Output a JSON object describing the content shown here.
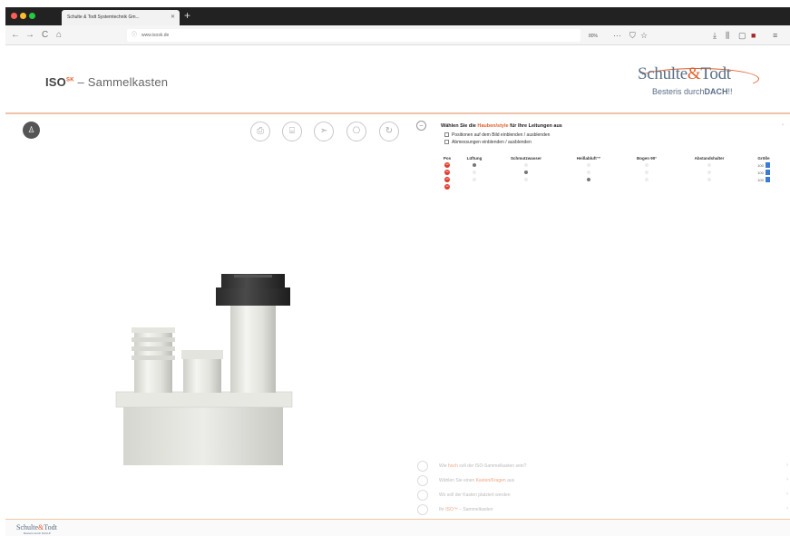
{
  "browser": {
    "tab_title": "Schulte & Todt Systemtechnik Gm...",
    "tab_close": "✕",
    "new_tab": "+",
    "url": "www.isosk.de",
    "zoom": "80%",
    "nav": {
      "back": "←",
      "forward": "→",
      "reload": "C",
      "home": "⌂"
    },
    "right_icons": {
      "dots": "···",
      "shield": "⛉",
      "star": "☆",
      "download": "⤓",
      "library": "⫼",
      "sidebar": "▢",
      "ext": "■",
      "menu": "≡"
    }
  },
  "header": {
    "title_prefix": "ISO",
    "title_sup": "SK",
    "title_rest": " – Sammelkasten",
    "logo_part1": "Schulte",
    "logo_amp": "&",
    "logo_part2": "Todt",
    "logo_tag_normal": "Besteris durch",
    "logo_tag_bold": "DACH",
    "logo_tag_end": "!!"
  },
  "toolbar": {
    "user_icon": "♙",
    "tools": [
      "⎙",
      "⌸",
      "➣",
      "⎔",
      "↻"
    ],
    "collapse": "–"
  },
  "panel": {
    "question_pre": "Wählen Sie die ",
    "question_hl": "Hauben/style",
    "question_post": " für Ihre Leitungen aus",
    "caret": "›",
    "options": [
      "Positionen auf dem Bild einblenden / ausblenden",
      "Abmessungen einblenden / ausblenden"
    ],
    "columns": [
      "Pos",
      "Lüftung",
      "Schmutzwasser",
      "Heißabluft™",
      "Bogen 90°",
      "Abstandshalter",
      "Größe"
    ],
    "rows": [
      {
        "pos": "−",
        "selected": 1,
        "size": "100"
      },
      {
        "pos": "−",
        "selected": 2,
        "size": "100"
      },
      {
        "pos": "−",
        "selected": 3,
        "size": "100"
      },
      {
        "pos": "−",
        "selected": -1,
        "size": ""
      }
    ]
  },
  "steps": [
    {
      "pre": "Wie ",
      "hl": "hoch",
      "post": " soll der ISO-Sammelkasten sein?"
    },
    {
      "pre": "Wählen Sie einen ",
      "hl": "Kasten/Kragen",
      "post": " aus"
    },
    {
      "pre": "Wo soll der Kasten platziert werden",
      "hl": "",
      "post": ""
    },
    {
      "pre": "Ihr ",
      "hl": "ISO™",
      "post": " – Sammelkasten"
    }
  ],
  "footer": {
    "logo_part1": "Schulte",
    "logo_amp": "&",
    "logo_part2": "Todt",
    "tag": "Besteris durch DACH!!"
  },
  "colors": {
    "accent": "#e05e2b",
    "brand_blue": "#5a6e86",
    "remove_red": "#e23b2e"
  }
}
